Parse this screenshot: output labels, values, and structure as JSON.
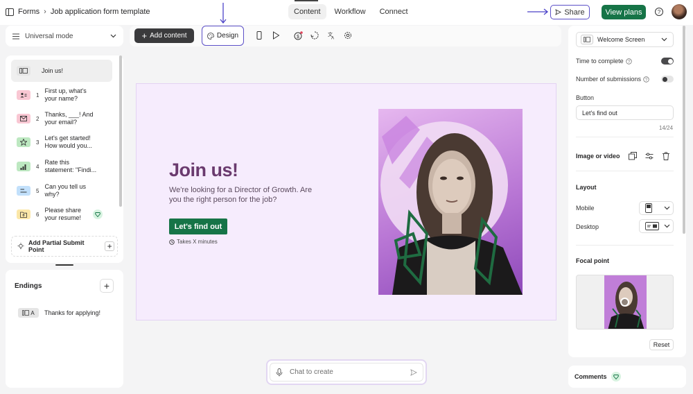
{
  "breadcrumb": {
    "root": "Forms",
    "title": "Job application form template"
  },
  "tabs": [
    {
      "label": "Content"
    },
    {
      "label": "Workflow"
    },
    {
      "label": "Connect"
    }
  ],
  "header": {
    "share_label": "Share",
    "view_plans_label": "View plans"
  },
  "sidebar": {
    "mode_label": "Universal mode",
    "questions": [
      {
        "num": "",
        "label": "Join us!",
        "color": "#e5e5e5",
        "icon": "welcome-screen-icon"
      },
      {
        "num": "1",
        "label": "First up, what's your name?",
        "color": "#f9c7d3",
        "icon": "contact-icon"
      },
      {
        "num": "2",
        "label": "Thanks, ___! And your email?",
        "color": "#f9c7d3",
        "icon": "mail-icon"
      },
      {
        "num": "3",
        "label": "Let's get started! How would you...",
        "color": "#bde8c1",
        "icon": "star-icon"
      },
      {
        "num": "4",
        "label": "Rate this statement: \"Findi...",
        "color": "#bde8c1",
        "icon": "bar-chart-icon"
      },
      {
        "num": "5",
        "label": "Can you tell us why?",
        "color": "#c2e0fb",
        "icon": "text-icon"
      },
      {
        "num": "6",
        "label": "Please share your resume!",
        "color": "#fbe7a8",
        "icon": "file-upload-icon"
      }
    ],
    "partial_submit_label": "Add Partial Submit Point",
    "endings_title": "Endings",
    "endings": [
      {
        "prefix": "A",
        "label": "Thanks for applying!"
      }
    ]
  },
  "toolbar": {
    "add_content_label": "Add content",
    "design_label": "Design"
  },
  "canvas": {
    "heading": "Join us!",
    "subtext": "We're looking for a Director of Growth. Are you the right person for the job?",
    "button_label": "Let's find out",
    "time_note": "Takes X minutes"
  },
  "chat": {
    "placeholder": "Chat to create"
  },
  "settings": {
    "screen_type": "Welcome Screen",
    "time_to_complete_label": "Time to complete",
    "time_to_complete_on": true,
    "submissions_label": "Number of submissions",
    "submissions_on": false,
    "button_section_label": "Button",
    "button_value": "Let's find out",
    "char_count": "14/24",
    "image_label": "Image or video",
    "layout_title": "Layout",
    "mobile_label": "Mobile",
    "desktop_label": "Desktop",
    "focal_title": "Focal point",
    "reset_label": "Reset"
  },
  "comments_label": "Comments",
  "colors": {
    "accent": "#5b4fc7",
    "brand_green": "#167447",
    "heading_purple": "#6a3a6e"
  }
}
